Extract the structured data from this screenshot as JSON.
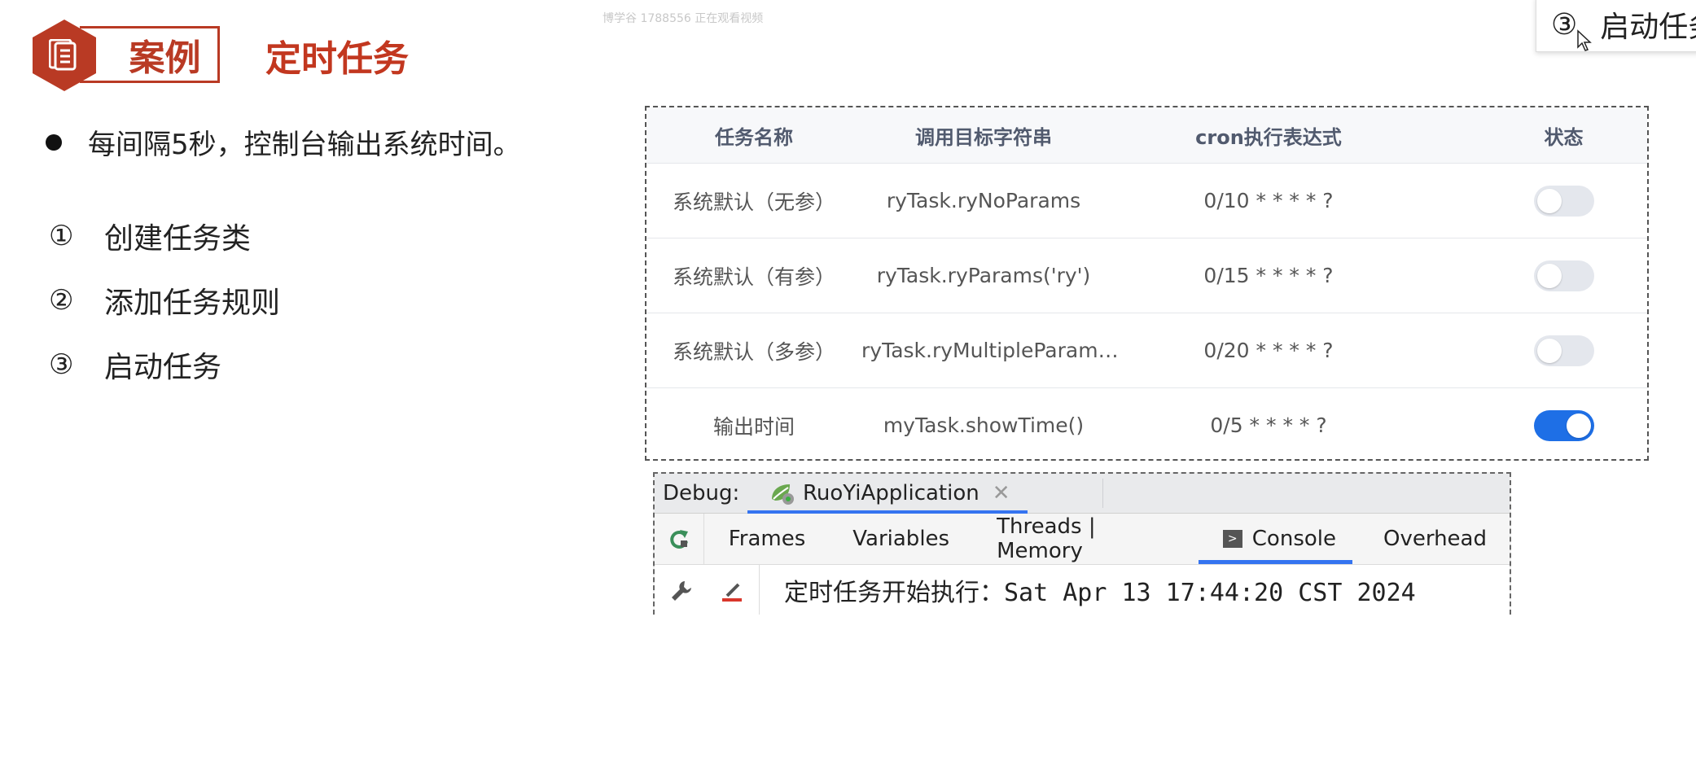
{
  "watermark": "博学谷 1788556 正在观看视频",
  "header": {
    "badge": "案例",
    "title": "定时任务"
  },
  "bullet": "每间隔5秒，控制台输出系统时间。",
  "steps": [
    {
      "num": "①",
      "text": "创建任务类"
    },
    {
      "num": "②",
      "text": "添加任务规则"
    },
    {
      "num": "③",
      "text": "启动任务"
    }
  ],
  "tooltip": {
    "num": "③",
    "text": "启动任务"
  },
  "task_table": {
    "columns": [
      "任务名称",
      "调用目标字符串",
      "cron执行表达式",
      "状态"
    ],
    "rows": [
      {
        "name": "系统默认（无参）",
        "target": "ryTask.ryNoParams",
        "cron": "0/10 * * * * ?",
        "status": false
      },
      {
        "name": "系统默认（有参）",
        "target": "ryTask.ryParams('ry')",
        "cron": "0/15 * * * * ?",
        "status": false
      },
      {
        "name": "系统默认（多参）",
        "target": "ryTask.ryMultipleParam…",
        "cron": "0/20 * * * * ?",
        "status": false
      },
      {
        "name": "输出时间",
        "target": "myTask.showTime()",
        "cron": "0/5 * * * * ?",
        "status": true
      }
    ]
  },
  "debug": {
    "label": "Debug:",
    "run_tab": "RuoYiApplication",
    "tabs": [
      "Frames",
      "Variables",
      "Threads | Memory",
      "Console",
      "Overhead"
    ],
    "active_tab": "Console",
    "console_output": "定时任务开始执行：Sat Apr 13 17:44:20 CST 2024"
  },
  "colors": {
    "brand_red": "#b93a24",
    "toggle_on": "#1e6fe6",
    "tab_underline": "#3574f0"
  }
}
